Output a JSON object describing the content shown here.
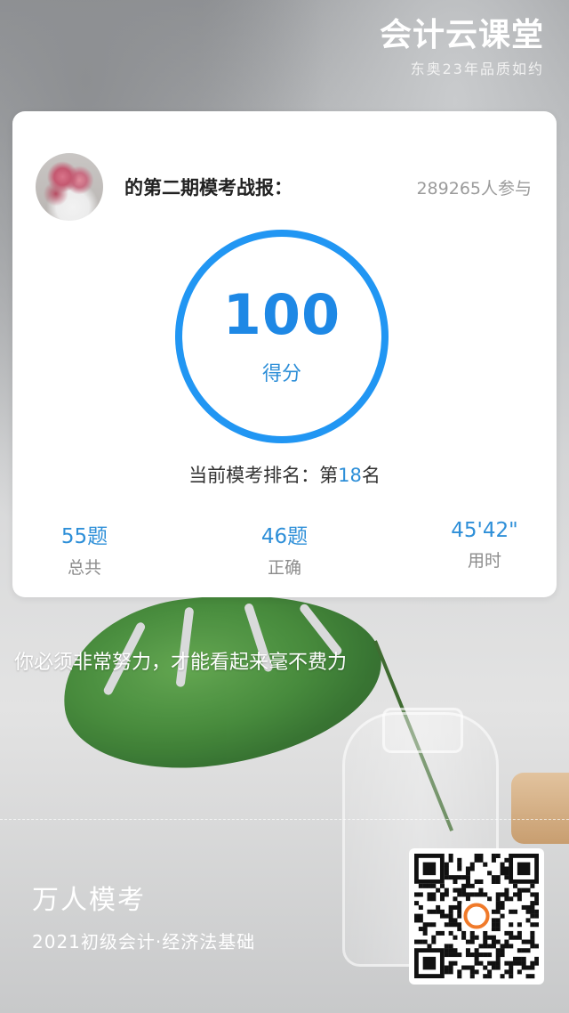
{
  "brand": {
    "title": "会计云课堂",
    "subtitle": "东奥23年品质如约"
  },
  "report": {
    "title": "的第二期模考战报：",
    "participants": "289265人参与",
    "score": "100",
    "score_label": "得分",
    "score_fraction": 1.0,
    "rank_prefix": "当前模考排名：第",
    "rank_number": "18",
    "rank_suffix": "名"
  },
  "stats": [
    {
      "value": "55题",
      "label": "总共"
    },
    {
      "value": "46题",
      "label": "正确"
    },
    {
      "value": "45'42\"",
      "label": "用时"
    }
  ],
  "motto": "你必须非常努力，才能看起来毫不费力",
  "footer": {
    "title": "万人模考",
    "subtitle": "2021初级会计·经济法基础"
  },
  "colors": {
    "accent": "#2e8fd8",
    "score": "#1e88e5",
    "ring": "#2196f3"
  },
  "icons": {
    "avatar": "flower-avatar",
    "qr": "qr-code",
    "logo": "dongao-logo-icon"
  }
}
